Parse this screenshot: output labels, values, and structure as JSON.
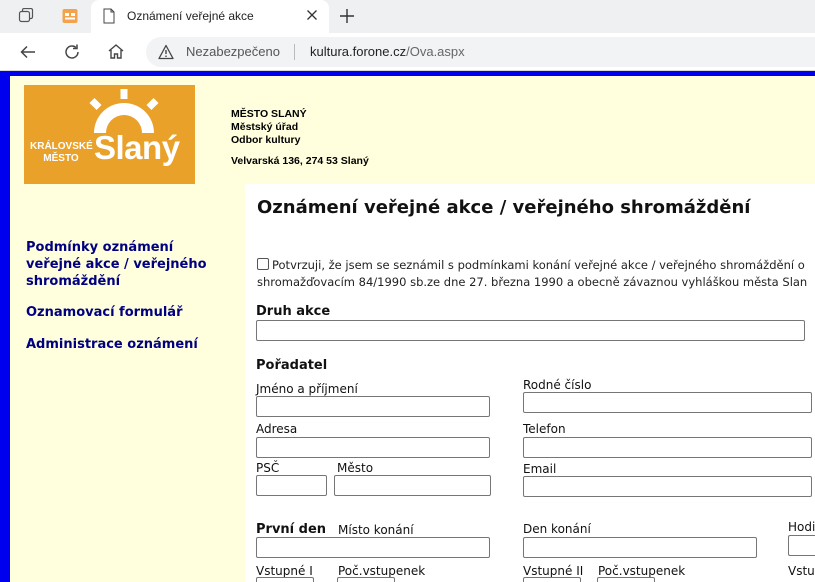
{
  "browser": {
    "tab_title": "Oznámení veřejné akce",
    "security_label": "Nezabezpečeno",
    "url_domain": "kultura.forone.cz",
    "url_path": "/Ova.aspx"
  },
  "header": {
    "logo_line1": "KRÁLOVSKÉ",
    "logo_line2": "MĚSTO",
    "logo_name": "Slaný",
    "org_line1": "MĚSTO SLANÝ",
    "org_line2": "Městský úřad",
    "org_line3": "Odbor kultury",
    "address": "Velvarská 136, 274 53 Slaný"
  },
  "sidebar": {
    "items": [
      {
        "label": "Podmínky oznámení veřejné akce / veřejného shromáždění"
      },
      {
        "label": "Oznamovací formulář"
      },
      {
        "label": "Administrace oznámení"
      }
    ]
  },
  "form": {
    "title": "Oznámení veřejné akce / veřejného shromáždění",
    "confirm_line1": "Potvrzuji, že jsem se seznámil s podmínkami konání veřejné akce / veřejného shromáždění o",
    "confirm_line2": "shromažďovacím 84/1990 sb.ze dne 27. března 1990 a obecně závaznou vyhláškou města Slan",
    "druh_akce": "Druh akce",
    "poradatel": "Pořadatel",
    "jmeno": "Jméno a příjmení",
    "rodne_cislo": "Rodné číslo",
    "adresa": "Adresa",
    "telefon": "Telefon",
    "psc": "PSČ",
    "mesto": "Město",
    "email": "Email",
    "prvni_den": "První den",
    "misto_konani": "Místo konání",
    "den_konani": "Den konání",
    "hodiny": "Hodi",
    "vstupne1": "Vstupné I",
    "poc_vstupenek1": "Poč.vstupenek",
    "vstupne2": "Vstupné II",
    "poc_vstupenek2": "Poč.vstupenek",
    "vstupne3": "Vstu"
  }
}
